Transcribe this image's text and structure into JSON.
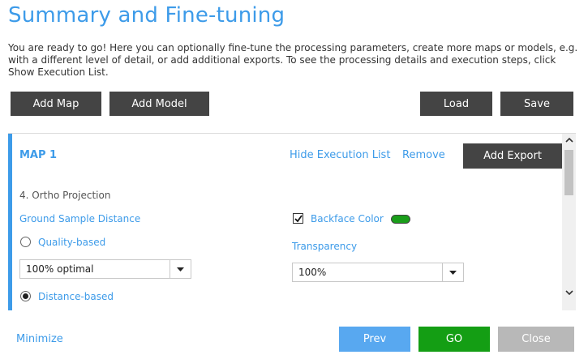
{
  "header": {
    "title": "Summary and Fine-tuning",
    "intro": "You are ready to go! Here you can optionally fine-tune the processing parameters, create more maps or models, e.g. with a different level of detail, or add additional exports. To see the processing details and execution steps, click Show Execution List."
  },
  "toolbar": {
    "add_map": "Add Map",
    "add_model": "Add Model",
    "load": "Load",
    "save": "Save"
  },
  "map": {
    "title": "MAP 1",
    "hide_execution_list": "Hide Execution List",
    "remove": "Remove",
    "add_export": "Add Export",
    "section": "4. Ortho Projection",
    "ground_sample_distance": {
      "label": "Ground Sample Distance",
      "quality_based": "Quality-based",
      "quality_select_value": "100% optimal",
      "distance_based": "Distance-based",
      "selected": "distance_based"
    },
    "backface_color": {
      "label": "Backface Color",
      "checked": true,
      "color": "#1a9e1a"
    },
    "transparency": {
      "label": "Transparency",
      "value": "100%"
    }
  },
  "footer": {
    "minimize": "Minimize",
    "prev": "Prev",
    "go": "GO",
    "close": "Close"
  },
  "colors": {
    "accent": "#3d9be9",
    "dark_button": "#444444",
    "go_button": "#149e14",
    "prev_button": "#58a8f0",
    "close_button": "#b8b8b8"
  }
}
